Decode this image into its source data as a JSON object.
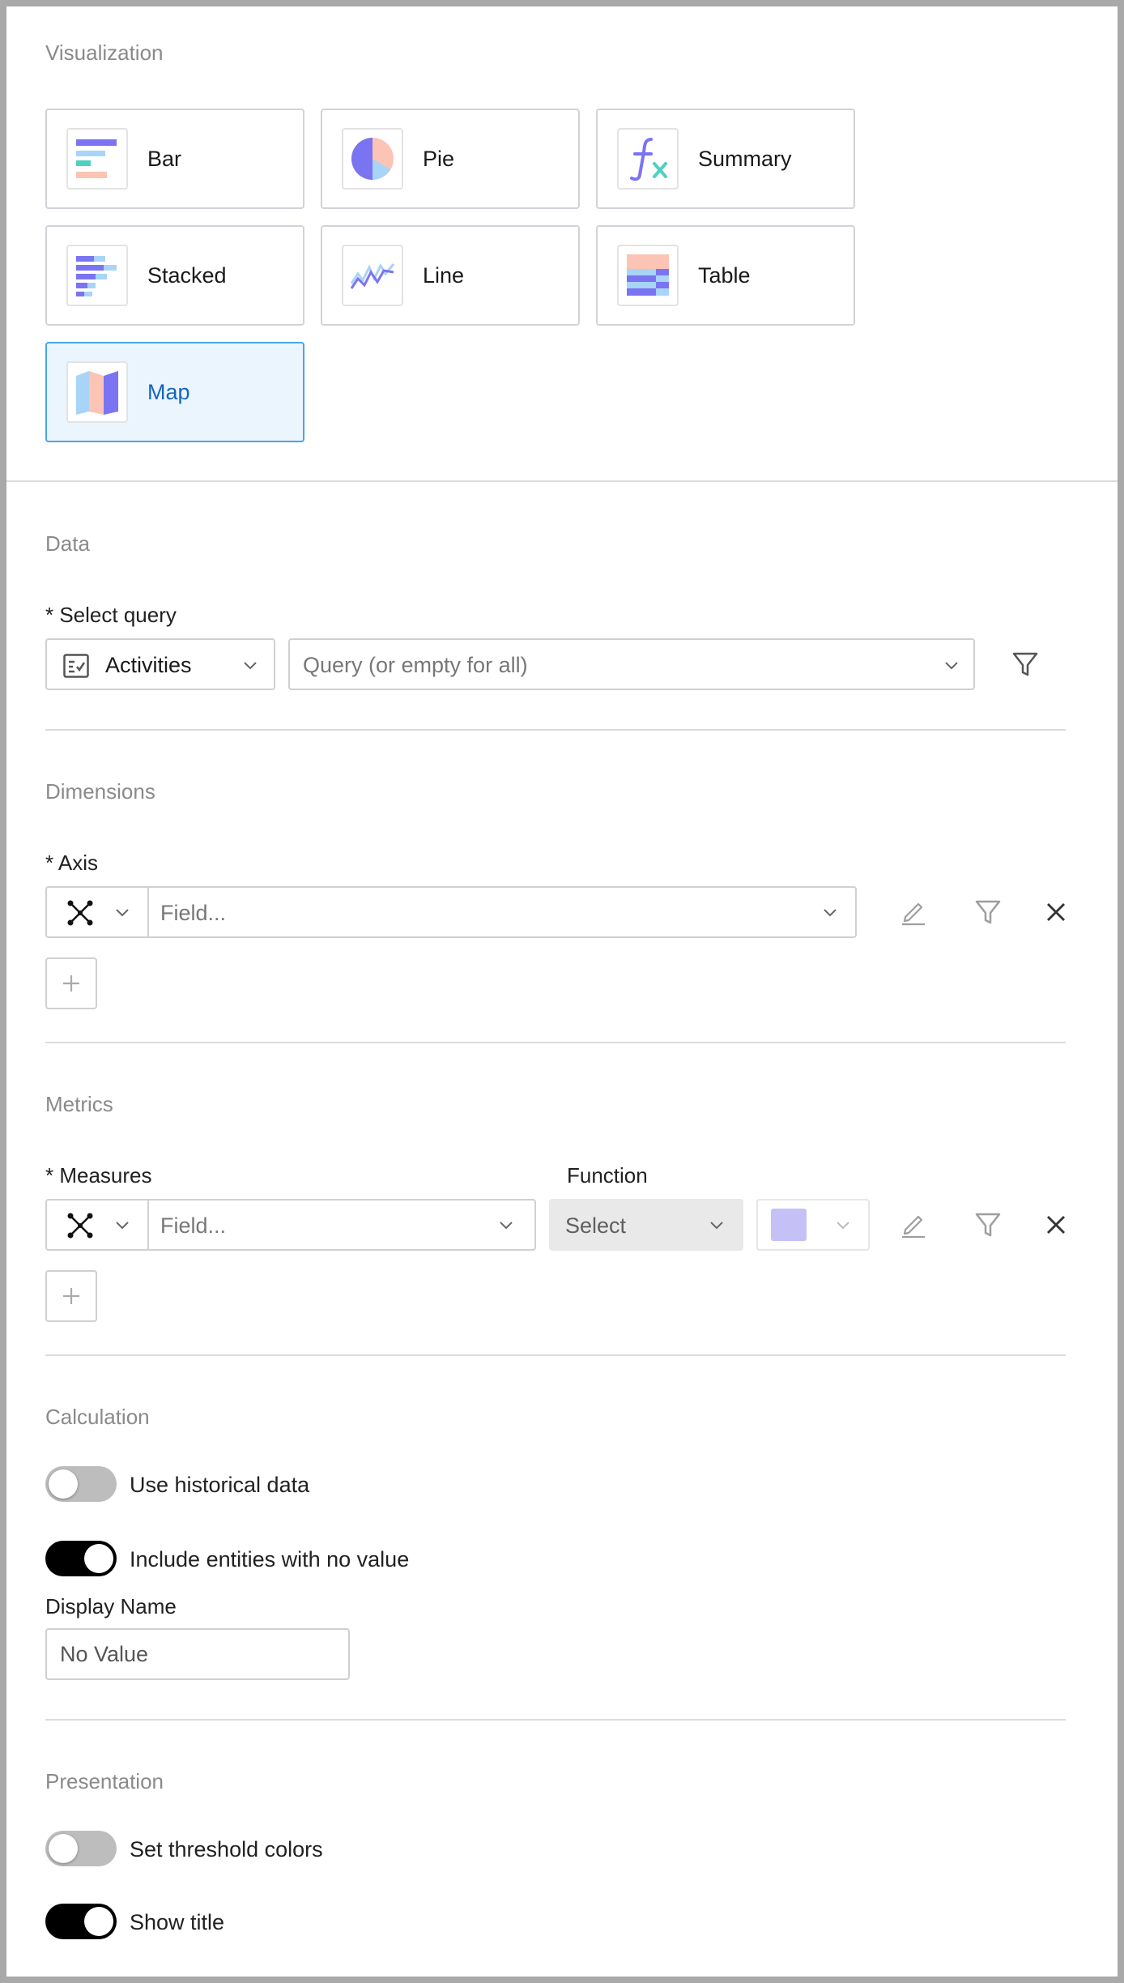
{
  "visualization": {
    "title": "Visualization",
    "tiles": [
      {
        "label": "Bar",
        "icon": "bar-chart-icon",
        "selected": false
      },
      {
        "label": "Pie",
        "icon": "pie-chart-icon",
        "selected": false
      },
      {
        "label": "Summary",
        "icon": "function-fx-icon",
        "selected": false
      },
      {
        "label": "Stacked",
        "icon": "stacked-bar-icon",
        "selected": false
      },
      {
        "label": "Line",
        "icon": "line-chart-icon",
        "selected": false
      },
      {
        "label": "Table",
        "icon": "table-icon",
        "selected": false
      },
      {
        "label": "Map",
        "icon": "map-icon",
        "selected": true
      }
    ]
  },
  "data": {
    "title": "Data",
    "select_query_label": "* Select query",
    "entity_value": "Activities",
    "query_placeholder": "Query (or empty for all)"
  },
  "dimensions": {
    "title": "Dimensions",
    "axis_label": "* Axis",
    "field_placeholder": "Field..."
  },
  "metrics": {
    "title": "Metrics",
    "measures_label": "* Measures",
    "function_label": "Function",
    "field_placeholder": "Field...",
    "function_value": "Select",
    "color_swatch": "#c5c1f7"
  },
  "calculation": {
    "title": "Calculation",
    "use_historical_label": "Use historical data",
    "use_historical_on": false,
    "include_entities_label": "Include entities with no value",
    "include_entities_on": true,
    "display_name_label": "Display Name",
    "display_name_value": "No Value"
  },
  "presentation": {
    "title": "Presentation",
    "threshold_label": "Set threshold colors",
    "threshold_on": false,
    "show_title_label": "Show title",
    "show_title_on": true
  },
  "colors": {
    "accent_blue": "#4aa3ea",
    "selected_bg": "#ebf5fd",
    "toggle_on": "#000000",
    "toggle_off": "#bdbdbd",
    "chart_purple": "#7b74f2",
    "chart_lightblue": "#a8d4f7",
    "chart_peach": "#fbc4b5",
    "chart_teal": "#4fd1c1"
  }
}
